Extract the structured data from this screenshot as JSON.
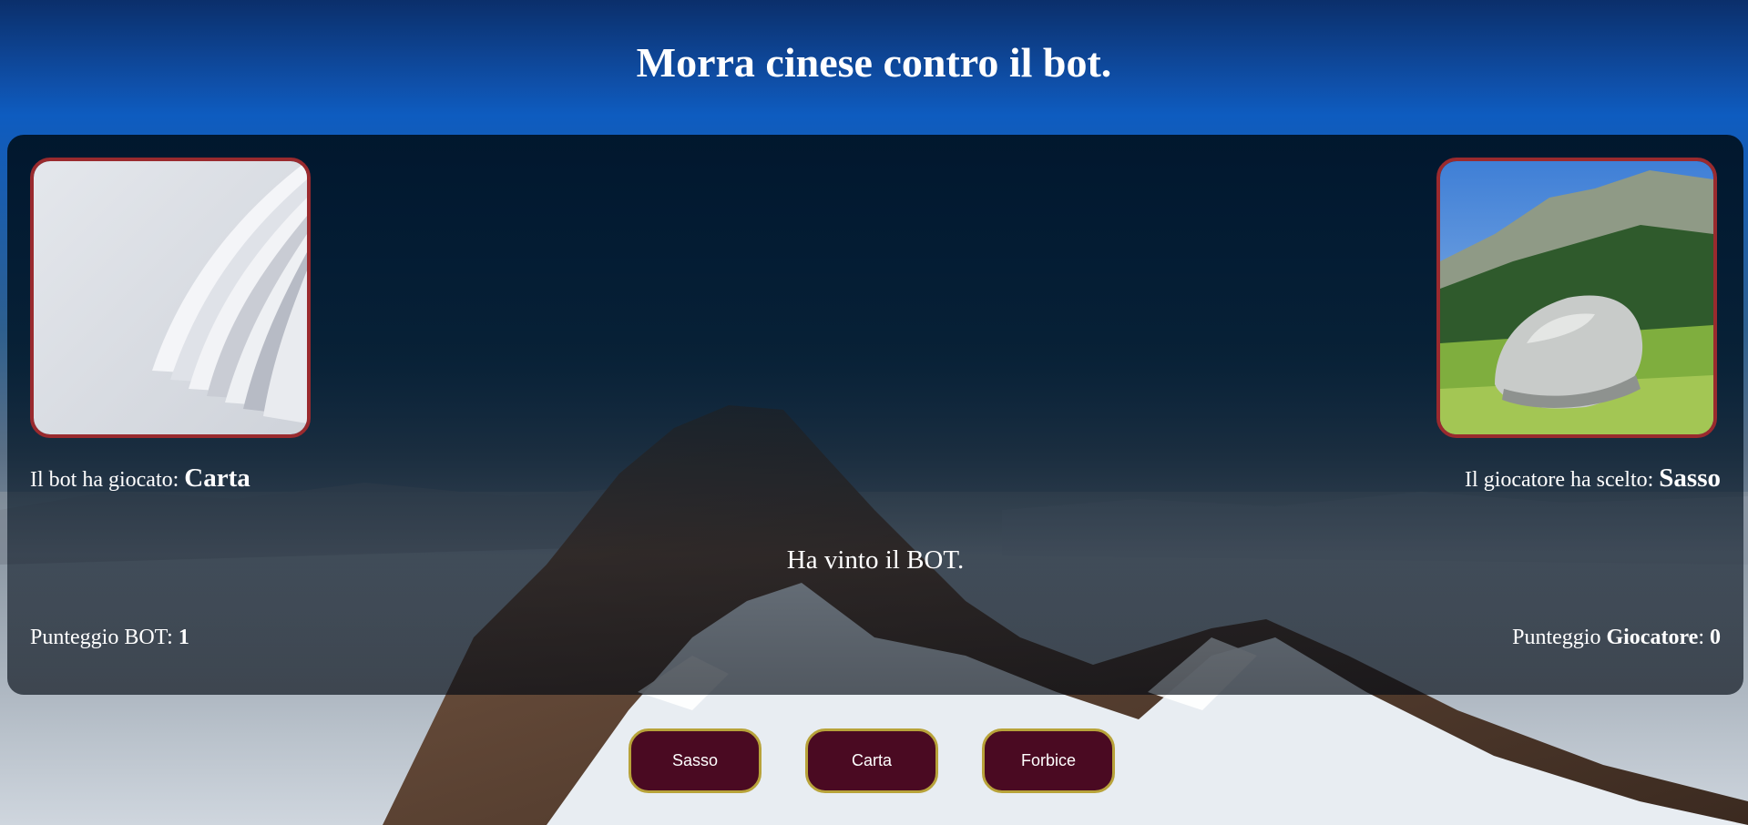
{
  "header": {
    "title": "Morra cinese contro il bot."
  },
  "bot": {
    "image_icon": "paper-sheets-icon",
    "played_label": "Il bot ha giocato: ",
    "played_value": "Carta",
    "score_label": "Punteggio BOT: ",
    "score_value": "1"
  },
  "player": {
    "image_icon": "rock-boulder-icon",
    "chose_label": "Il giocatore ha scelto: ",
    "chose_value": "Sasso",
    "score_label_prefix": "Punteggio ",
    "score_label_bold": "Giocatore",
    "score_label_sep": ": ",
    "score_value": "0"
  },
  "result": {
    "text": "Ha vinto il BOT."
  },
  "controls": {
    "rock_label": "Sasso",
    "paper_label": "Carta",
    "scissors_label": "Forbice"
  },
  "colors": {
    "card_border": "#9a2a2e",
    "button_bg": "#4a0a22",
    "button_border": "#b8a33a"
  }
}
